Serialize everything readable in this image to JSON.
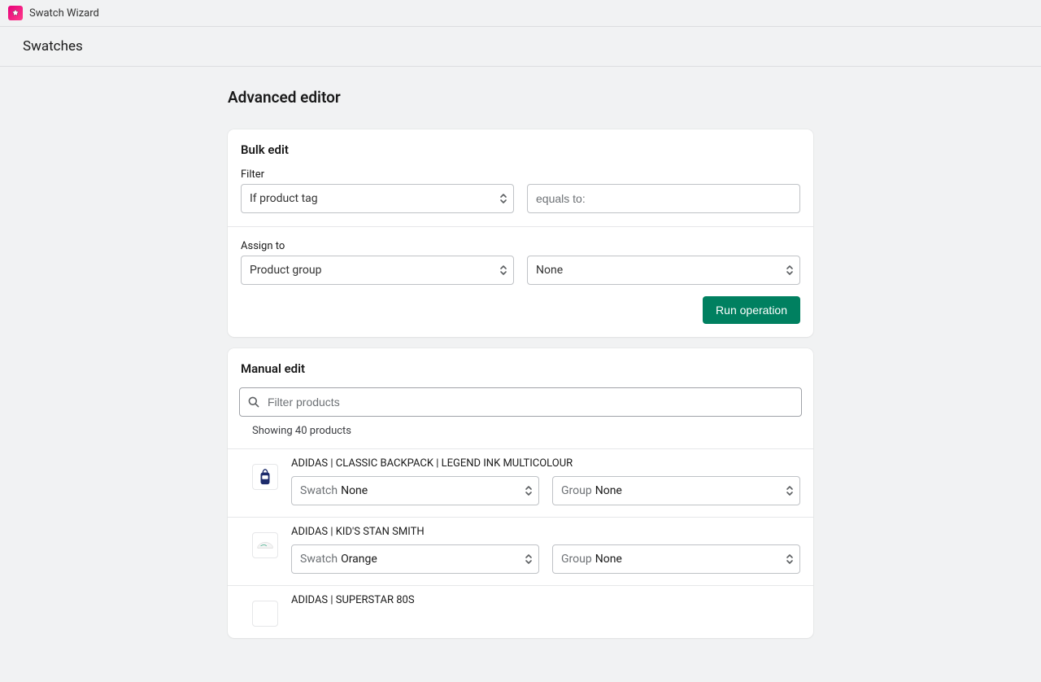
{
  "app": {
    "name": "Swatch Wizard"
  },
  "subbar": {
    "title": "Swatches"
  },
  "page": {
    "title": "Advanced editor"
  },
  "bulk": {
    "title": "Bulk edit",
    "filter_label": "Filter",
    "filter_select": "If product tag",
    "filter_input_placeholder": "equals to:",
    "assign_label": "Assign to",
    "assign_select": "Product group",
    "assign_value": "None",
    "run_button": "Run operation"
  },
  "manual": {
    "title": "Manual edit",
    "search_placeholder": "Filter products",
    "counts": "Showing 40 products",
    "swatch_prefix": "Swatch",
    "group_prefix": "Group",
    "products": [
      {
        "name": "ADIDAS | CLASSIC BACKPACK | LEGEND INK MULTICOLOUR",
        "swatch": "None",
        "group": "None",
        "thumb": "backpack"
      },
      {
        "name": "ADIDAS | KID'S STAN SMITH",
        "swatch": "Orange",
        "group": "None",
        "thumb": "shoe"
      },
      {
        "name": "ADIDAS | SUPERSTAR 80S",
        "swatch": "",
        "group": "",
        "thumb": "blank"
      }
    ]
  }
}
